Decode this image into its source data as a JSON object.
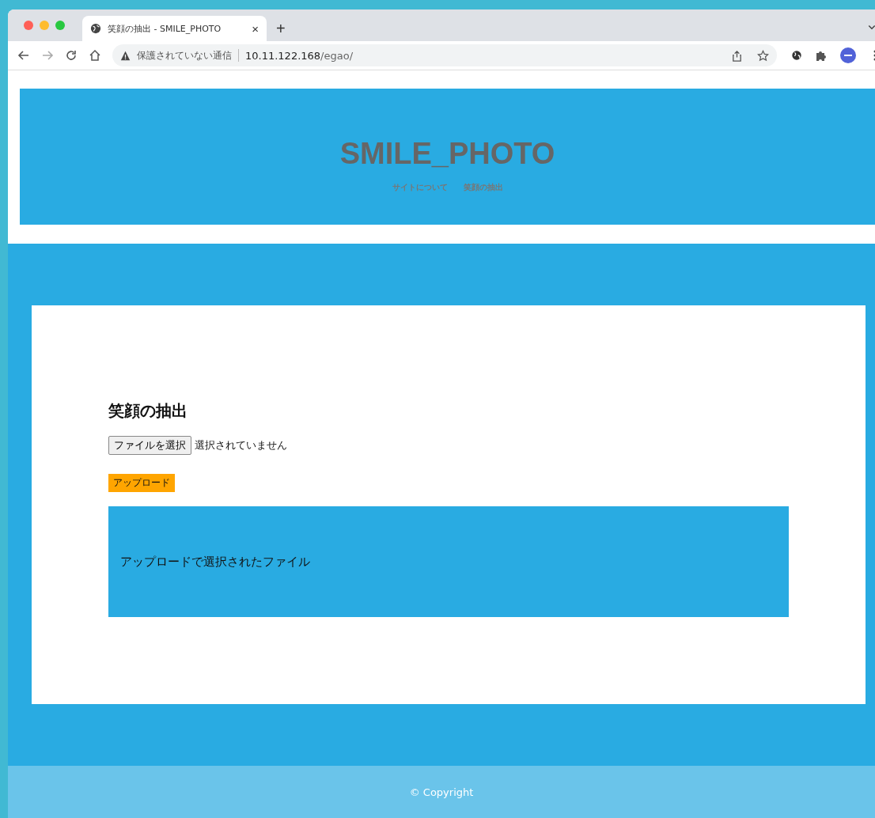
{
  "browser": {
    "tab": {
      "title": "笑顔の抽出 - SMILE_PHOTO",
      "close": "×"
    },
    "new_tab": "+",
    "address_bar": {
      "security_label": "保護されていない通信",
      "url_host": "10.11.122.168",
      "url_path": "/egao/"
    }
  },
  "site": {
    "title": "SMILE_PHOTO",
    "nav": [
      {
        "label": "サイトについて"
      },
      {
        "label": "笑顔の抽出"
      }
    ]
  },
  "main": {
    "heading": "笑顔の抽出",
    "file_input": {
      "button": "ファイルを選択",
      "status": "選択されていません"
    },
    "upload_button": "アップロード",
    "result_panel": {
      "text": "アップロードで選択されたファイル"
    }
  },
  "footer": {
    "copyright": "© Copyright"
  }
}
